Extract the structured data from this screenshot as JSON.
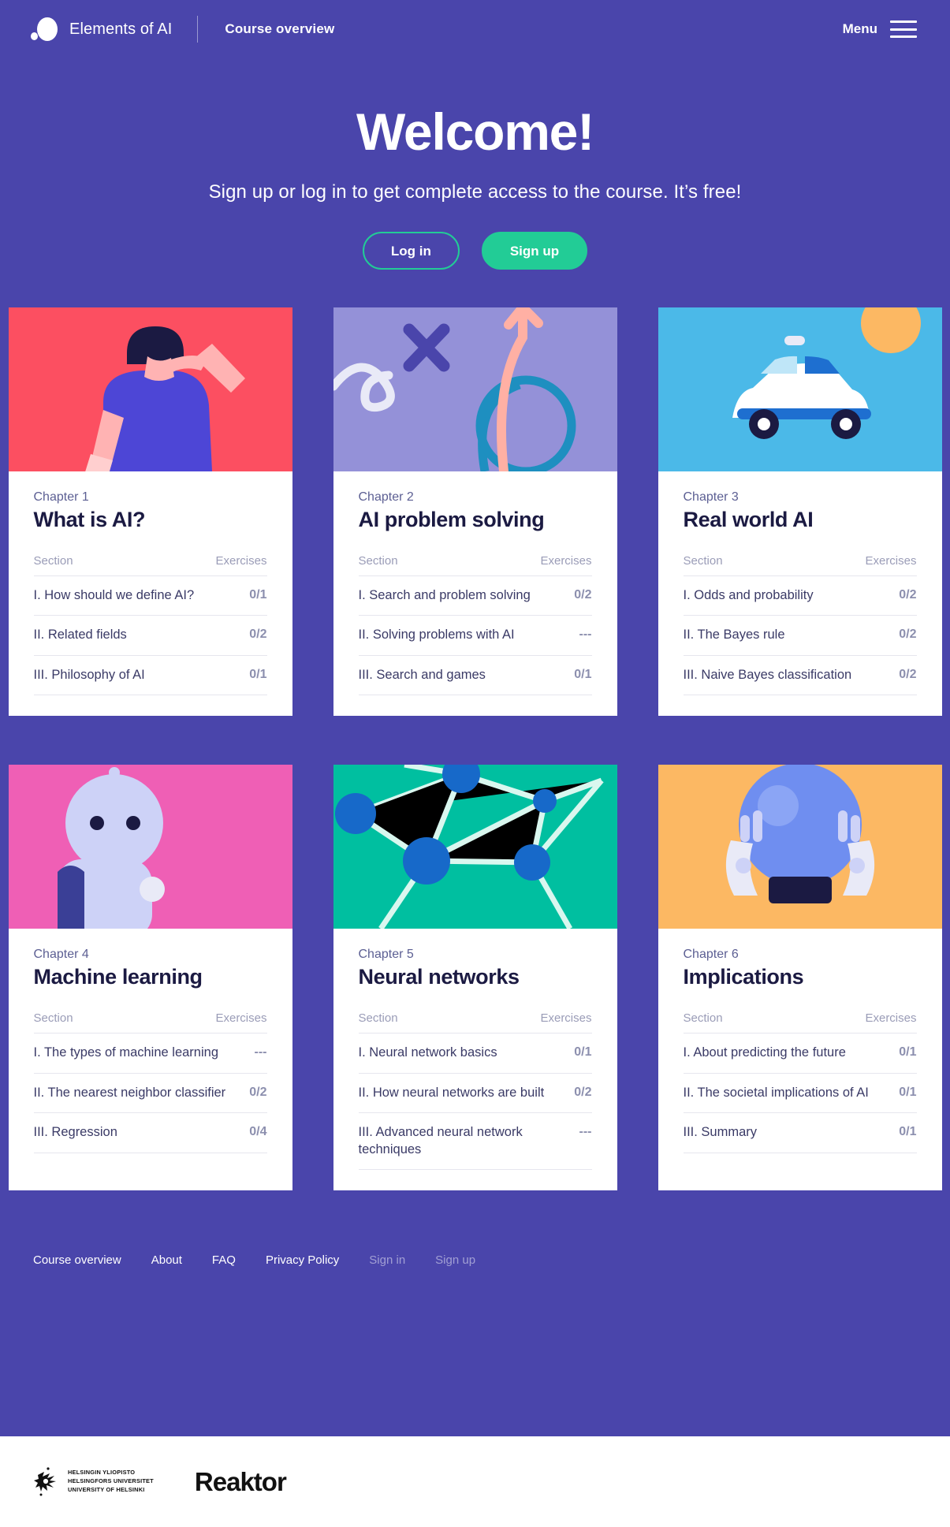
{
  "header": {
    "brand": "Elements of AI",
    "nav_link": "Course overview",
    "menu_label": "Menu"
  },
  "hero": {
    "title": "Welcome!",
    "subtitle": "Sign up or log in to get complete access to the course. It’s free!",
    "login_button": "Log in",
    "signup_button": "Sign up"
  },
  "table_headers": {
    "section": "Section",
    "exercises": "Exercises"
  },
  "cards": [
    {
      "chapter": "Chapter 1",
      "title": "What is AI?",
      "art_bg": "#fc4f61",
      "sections": [
        {
          "name": "I. How should we define AI?",
          "count": "0/1"
        },
        {
          "name": "II. Related fields",
          "count": "0/2"
        },
        {
          "name": "III. Philosophy of AI",
          "count": "0/1"
        }
      ]
    },
    {
      "chapter": "Chapter 2",
      "title": "AI problem solving",
      "art_bg": "#9491d8",
      "sections": [
        {
          "name": "I. Search and problem solving",
          "count": "0/2"
        },
        {
          "name": "II. Solving problems with AI",
          "count": "---"
        },
        {
          "name": "III. Search and games",
          "count": "0/1"
        }
      ]
    },
    {
      "chapter": "Chapter 3",
      "title": "Real world AI",
      "art_bg": "#4bb9e8",
      "sections": [
        {
          "name": "I. Odds and probability",
          "count": "0/2"
        },
        {
          "name": "II. The Bayes rule",
          "count": "0/2"
        },
        {
          "name": "III. Naive Bayes classification",
          "count": "0/2"
        }
      ]
    },
    {
      "chapter": "Chapter 4",
      "title": "Machine learning",
      "art_bg": "#ef5fb5",
      "sections": [
        {
          "name": "I. The types of machine learning",
          "count": "---"
        },
        {
          "name": "II. The nearest neighbor classifier",
          "count": "0/2"
        },
        {
          "name": "III. Regression",
          "count": "0/4"
        }
      ]
    },
    {
      "chapter": "Chapter 5",
      "title": "Neural networks",
      "art_bg": "#00bfa0",
      "sections": [
        {
          "name": "I. Neural network basics",
          "count": "0/1"
        },
        {
          "name": "II. How neural networks are built",
          "count": "0/2"
        },
        {
          "name": "III. Advanced neural network techniques",
          "count": "---"
        }
      ]
    },
    {
      "chapter": "Chapter 6",
      "title": "Implications",
      "art_bg": "#fcb863",
      "sections": [
        {
          "name": "I. About predicting the future",
          "count": "0/1"
        },
        {
          "name": "II. The societal implications of AI",
          "count": "0/1"
        },
        {
          "name": "III. Summary",
          "count": "0/1"
        }
      ]
    }
  ],
  "footer": {
    "links": [
      {
        "label": "Course overview",
        "dim": false
      },
      {
        "label": "About",
        "dim": false
      },
      {
        "label": "FAQ",
        "dim": false
      },
      {
        "label": "Privacy Policy",
        "dim": false
      },
      {
        "label": "Sign in",
        "dim": true
      },
      {
        "label": "Sign up",
        "dim": true
      }
    ],
    "university_lines": [
      "HELSINGIN YLIOPISTO",
      "HELSINGFORS UNIVERSITET",
      "UNIVERSITY OF HELSINKI"
    ],
    "partner": "Reaktor"
  },
  "colors": {
    "background": "#4a45ab",
    "accent_green": "#22cc96",
    "card_white": "#ffffff",
    "title_navy": "#1b1a42"
  }
}
